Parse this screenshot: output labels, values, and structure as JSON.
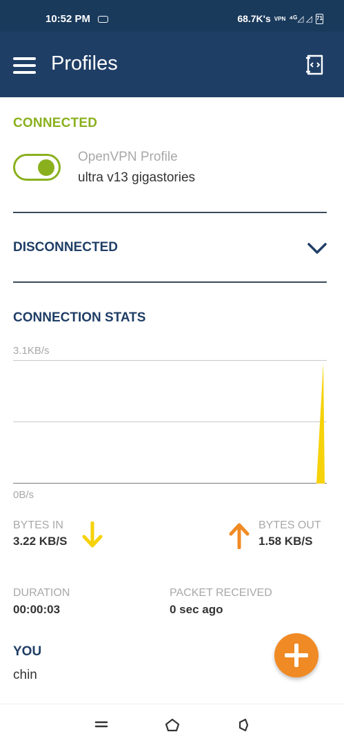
{
  "status_bar": {
    "time": "10:52 PM",
    "speed": "68.7K's",
    "vpn_label": "VPN",
    "signal_text": "⁴ᴳ◿ ◿",
    "battery": "71"
  },
  "app_bar": {
    "title": "Profiles",
    "menu_icon": "hamburger-menu-icon",
    "import_icon": "import-file-icon"
  },
  "connected": {
    "heading": "CONNECTED",
    "profile_type": "OpenVPN Profile",
    "profile_name": "ultra v13 gigastories",
    "toggle_on": true
  },
  "disconnected": {
    "heading": "DISCONNECTED"
  },
  "stats": {
    "heading": "CONNECTION STATS",
    "graph_max_label": "3.1KB/s",
    "graph_min_label": "0B/s",
    "bytes_in_label": "BYTES IN",
    "bytes_in_value": "3.22 KB/S",
    "bytes_out_label": "BYTES OUT",
    "bytes_out_value": "1.58 KB/S",
    "duration_label": "DURATION",
    "duration_value": "00:00:03",
    "packet_label": "PACKET RECEIVED",
    "packet_value": "0 sec ago"
  },
  "you": {
    "label": "YOU",
    "value": "chin"
  },
  "colors": {
    "app_bar": "#1f3e66",
    "status_bar": "#1a3a5c",
    "connected_green": "#8ab01e",
    "fab_orange": "#f08a24",
    "bytes_in_yellow": "#f5d20a",
    "bytes_out_orange": "#f08a24"
  }
}
